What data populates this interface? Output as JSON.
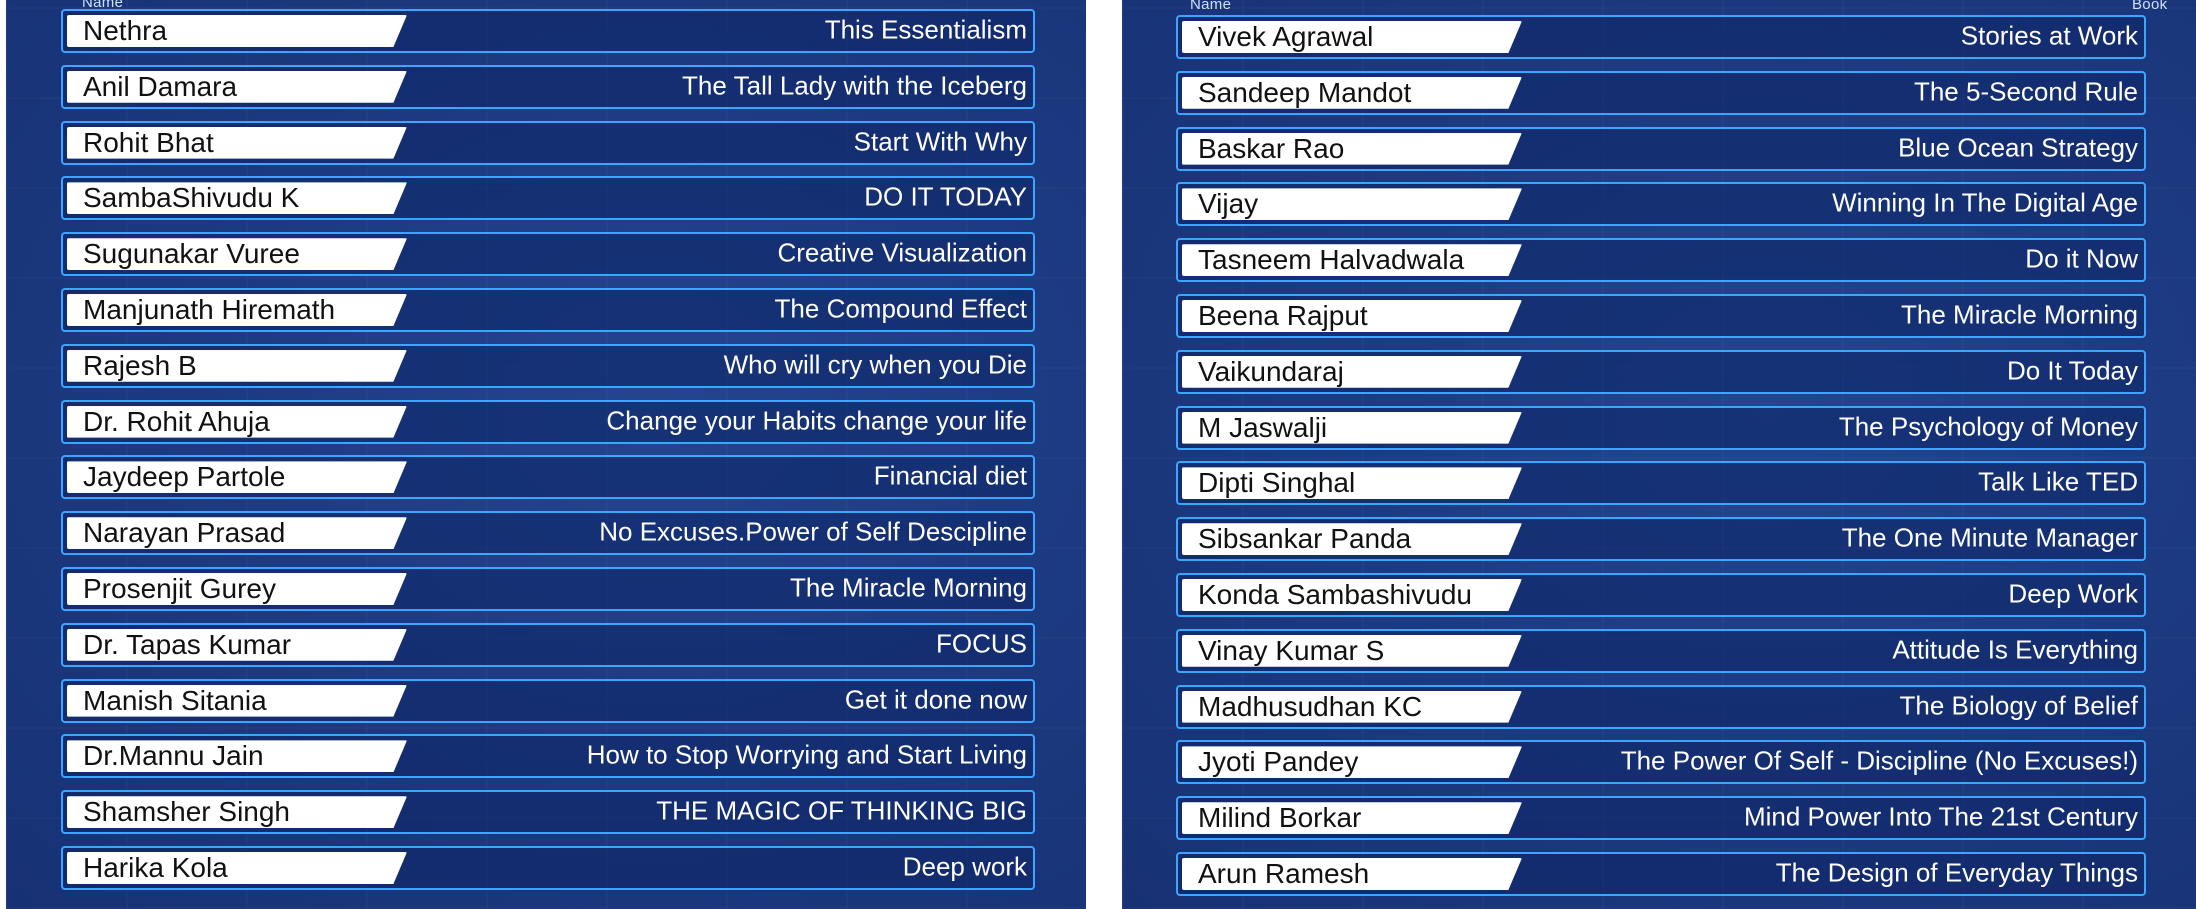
{
  "left": {
    "header_name": "Name",
    "rows": [
      {
        "name": "Nethra",
        "book": "This Essentialism"
      },
      {
        "name": "Anil Damara",
        "book": "The Tall Lady with the Iceberg"
      },
      {
        "name": "Rohit Bhat",
        "book": "Start With Why"
      },
      {
        "name": "SambaShivudu K",
        "book": "DO IT TODAY"
      },
      {
        "name": "Sugunakar Vuree",
        "book": "Creative Visualization"
      },
      {
        "name": "Manjunath Hiremath",
        "book": "The Compound Effect"
      },
      {
        "name": "Rajesh B",
        "book": "Who will cry when you Die"
      },
      {
        "name": "Dr. Rohit Ahuja",
        "book": "Change your Habits change your life"
      },
      {
        "name": "Jaydeep Partole",
        "book": "Financial diet"
      },
      {
        "name": "Narayan Prasad",
        "book": "No Excuses.Power of Self Descipline"
      },
      {
        "name": "Prosenjit Gurey",
        "book": "The Miracle Morning"
      },
      {
        "name": "Dr. Tapas Kumar",
        "book": "FOCUS"
      },
      {
        "name": "Manish Sitania",
        "book": "Get it done now"
      },
      {
        "name": "Dr.Mannu Jain",
        "book": "How to Stop Worrying and Start Living"
      },
      {
        "name": "Shamsher Singh",
        "book": "THE MAGIC OF THINKING BIG"
      },
      {
        "name": "Harika Kola",
        "book": "Deep work"
      }
    ]
  },
  "right": {
    "header_name": "Name",
    "header_book": "Book",
    "rows": [
      {
        "name": "Vivek Agrawal",
        "book": "Stories at Work"
      },
      {
        "name": "Sandeep Mandot",
        "book": "The 5-Second Rule"
      },
      {
        "name": "Baskar Rao",
        "book": "Blue Ocean Strategy"
      },
      {
        "name": "Vijay",
        "book": "Winning In The Digital Age"
      },
      {
        "name": "Tasneem Halvadwala",
        "book": "Do it Now"
      },
      {
        "name": "Beena Rajput",
        "book": "The Miracle Morning"
      },
      {
        "name": "Vaikundaraj",
        "book": "Do It Today"
      },
      {
        "name": "M Jaswalji",
        "book": "The Psychology of Money"
      },
      {
        "name": "Dipti Singhal",
        "book": "Talk Like TED"
      },
      {
        "name": "Sibsankar Panda",
        "book": "The One Minute Manager"
      },
      {
        "name": "Konda Sambashivudu",
        "book": "Deep Work"
      },
      {
        "name": "Vinay Kumar S",
        "book": "Attitude Is Everything"
      },
      {
        "name": "Madhusudhan KC",
        "book": "The Biology of Belief"
      },
      {
        "name": "Jyoti Pandey",
        "book": "The Power Of Self - Discipline  (No Excuses!)"
      },
      {
        "name": "Milind Borkar",
        "book": "Mind Power Into The 21st Century"
      },
      {
        "name": "Arun Ramesh",
        "book": "The Design of Everyday Things"
      }
    ]
  }
}
